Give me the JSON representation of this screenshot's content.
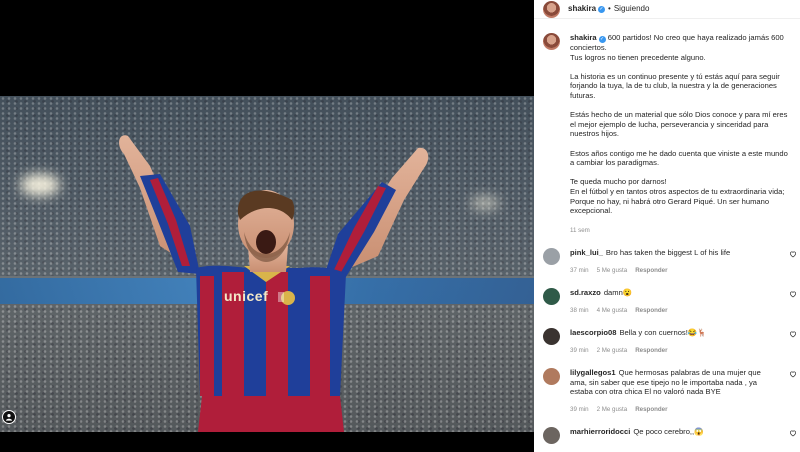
{
  "post": {
    "username": "shakira",
    "separator": "•",
    "follow_status": "Siguiendo",
    "caption_user": "shakira",
    "caption_paragraphs": [
      "600 partidos! No creo que haya realizado jamás 600 conciertos.\nTus logros no tienen precedente alguno.",
      "La historia es un continuo presente y tú estás aquí para seguir forjando la tuya, la de tu club, la nuestra y la de generaciones futuras.",
      "Estás hecho de un material que sólo Dios conoce y para mí eres el mejor ejemplo de lucha, perseverancia y sinceridad para nuestros hijos.",
      "Estos años contigo me he dado cuenta que viniste a este mundo a cambiar los paradigmas.",
      "Te queda mucho por darnos!\nEn el fútbol y en tantos otros aspectos de tu extraordinaria vida; Porque no hay, ni habrá otro Gerard Piqué. Un ser humano excepcional."
    ],
    "caption_time": "11 sem",
    "jersey_sponsor": "unicef"
  },
  "comments": [
    {
      "username": "pink_lui_",
      "text": "Bro has taken the biggest L of his life",
      "time": "37 min",
      "likes": "5 Me gusta",
      "reply": "Responder"
    },
    {
      "username": "sd.raxzo",
      "text": "damn😮",
      "time": "38 min",
      "likes": "4 Me gusta",
      "reply": "Responder"
    },
    {
      "username": "laescorpio08",
      "text": "Bella y con cuernos!😂🦌",
      "time": "39 min",
      "likes": "2 Me gusta",
      "reply": "Responder"
    },
    {
      "username": "lilygallegos1",
      "text": "Que hermosas palabras de una mujer que ama, sin saber que ese tipejo no le importaba nada , ya estaba con otra chica El no valoró nada BYE",
      "time": "39 min",
      "likes": "2 Me gusta",
      "reply": "Responder"
    },
    {
      "username": "marhierroridocci",
      "text": "Qe poco cerebro,,😱"
    }
  ],
  "colors": {
    "verified": "#3897f0",
    "secondary_text": "#8e8e8e",
    "jersey_blue": "#1f3f9a",
    "jersey_red": "#b01e3a"
  }
}
